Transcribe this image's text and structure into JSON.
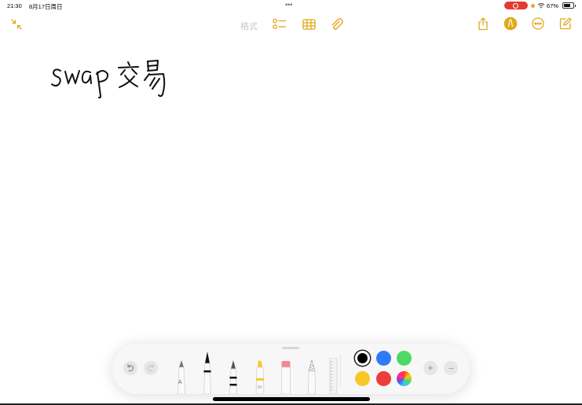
{
  "status": {
    "time": "21:30",
    "date": "8月17日周日",
    "dots": "•••",
    "battery_pct": "67%"
  },
  "toolbar": {
    "format_label": "格式",
    "icons": [
      "collapse-icon",
      "checklist-icon",
      "table-icon",
      "attachment-icon",
      "share-icon",
      "markup-pen-icon",
      "more-icon",
      "compose-icon"
    ],
    "accent_color": "#e2a81a"
  },
  "note": {
    "handwriting": "swap交易"
  },
  "palette": {
    "tools": [
      "pen-tool",
      "monoline-tool",
      "fountain-pen-tool",
      "highlighter-tool",
      "eraser-tool",
      "crayon-tool",
      "ruler-tool"
    ],
    "pen_tool_letter": "A",
    "highlighter_number": "80",
    "colors": [
      "#000000",
      "#2f7bf5",
      "#4cd964",
      "#f6c928",
      "#ee3b3b"
    ],
    "more_label": "···",
    "add_label": "+"
  }
}
